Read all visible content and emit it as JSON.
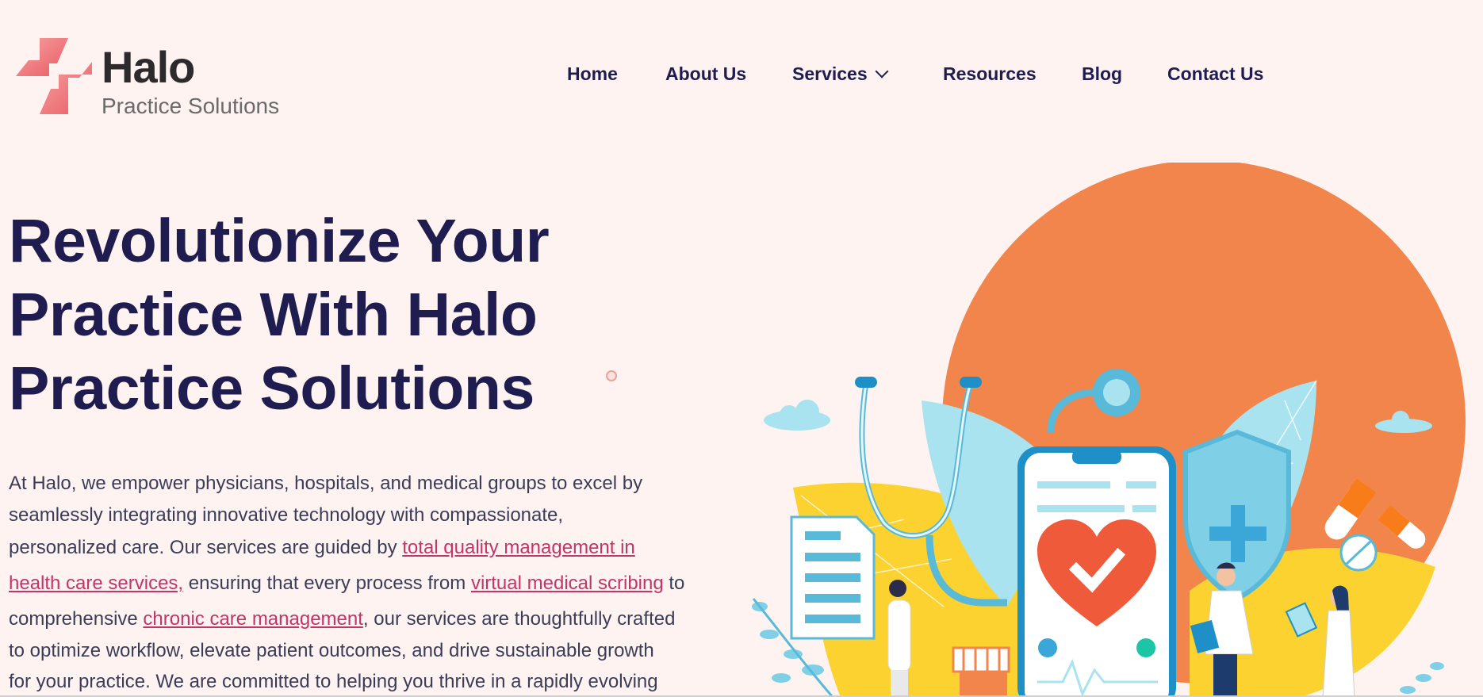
{
  "brand": {
    "name": "Halo",
    "tagline": "Practice Solutions"
  },
  "nav": {
    "items": [
      {
        "label": "Home"
      },
      {
        "label": "About Us"
      },
      {
        "label": "Services"
      },
      {
        "label": "Resources"
      },
      {
        "label": "Blog"
      },
      {
        "label": "Contact Us"
      }
    ]
  },
  "hero": {
    "title_lines": [
      "Revolutionize Your",
      "Practice With Halo",
      "Practice Solutions"
    ],
    "paragraph": {
      "line1": "At Halo, we empower physicians, hospitals, and medical groups to excel by",
      "line2": "seamlessly integrating innovative technology with compassionate,",
      "line3_pre": "personalized care. Our services are guided by ",
      "link_tqm_part1": "total quality management in",
      "link_tqm_part2": "health care services,",
      "line4_mid": " ensuring that every process from ",
      "link_scribing": "virtual medical scribing",
      "line4_post": " to",
      "line5_pre": "comprehensive ",
      "link_ccm": "chronic care management",
      "line5_post": ", our services are thoughtfully crafted",
      "line6": "to optimize workflow, elevate patient outcomes, and drive sustainable growth",
      "line7": "for your practice. We are committed to helping you thrive in a rapidly evolving"
    }
  },
  "illustration": {
    "subject": "medical-phone-heart-illustration"
  },
  "colors": {
    "background": "#fff3f1",
    "navy": "#1f1d4f",
    "link": "#c23566",
    "orange": "#f2854c",
    "yellow": "#fbd22f",
    "lightblue": "#a9e3f0",
    "blue": "#1e8fc7"
  }
}
